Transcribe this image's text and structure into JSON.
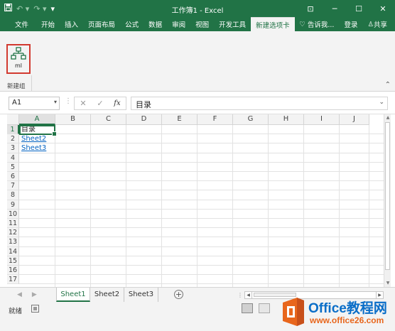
{
  "window": {
    "title": "工作簿1 - Excel",
    "controls": [
      "restore-ribbon",
      "minimize",
      "maximize",
      "close"
    ]
  },
  "qat": {
    "save_icon": "save-icon",
    "undo_icon": "undo-icon",
    "redo_icon": "redo-icon"
  },
  "ribbon_tabs": [
    {
      "label": "文件",
      "active": false
    },
    {
      "label": "开始",
      "active": false
    },
    {
      "label": "插入",
      "active": false
    },
    {
      "label": "页面布局",
      "active": false
    },
    {
      "label": "公式",
      "active": false
    },
    {
      "label": "数据",
      "active": false
    },
    {
      "label": "审阅",
      "active": false
    },
    {
      "label": "视图",
      "active": false
    },
    {
      "label": "开发工具",
      "active": false
    },
    {
      "label": "新建选项卡",
      "active": true
    }
  ],
  "ribbon_right": {
    "tellme": "告诉我...",
    "login": "登录",
    "share": "共享"
  },
  "ribbon": {
    "button_label": "ml",
    "group_name": "新建组"
  },
  "formula_bar": {
    "name_box": "A1",
    "fx": "fx",
    "content": "目录"
  },
  "grid": {
    "columns": [
      "A",
      "B",
      "C",
      "D",
      "E",
      "F",
      "G",
      "H",
      "I",
      "J"
    ],
    "rows": [
      "1",
      "2",
      "3",
      "4",
      "5",
      "6",
      "7",
      "8",
      "9",
      "10",
      "11",
      "12",
      "13",
      "14",
      "15",
      "16",
      "17"
    ],
    "selected_cell": "A1",
    "cells": [
      {
        "ref": "A1",
        "text": "目录",
        "link": false
      },
      {
        "ref": "A2",
        "text": "Sheet2",
        "link": true
      },
      {
        "ref": "A3",
        "text": "Sheet3",
        "link": true
      }
    ]
  },
  "sheets": [
    {
      "name": "Sheet1",
      "active": true
    },
    {
      "name": "Sheet2",
      "active": false
    },
    {
      "name": "Sheet3",
      "active": false
    }
  ],
  "status": {
    "ready": "就绪"
  },
  "watermark": {
    "brand": "Office教程网",
    "url": "www.office26.com"
  },
  "colors": {
    "excel_green": "#217346",
    "link_blue": "#0563c1",
    "highlight_red": "#d23a30"
  }
}
